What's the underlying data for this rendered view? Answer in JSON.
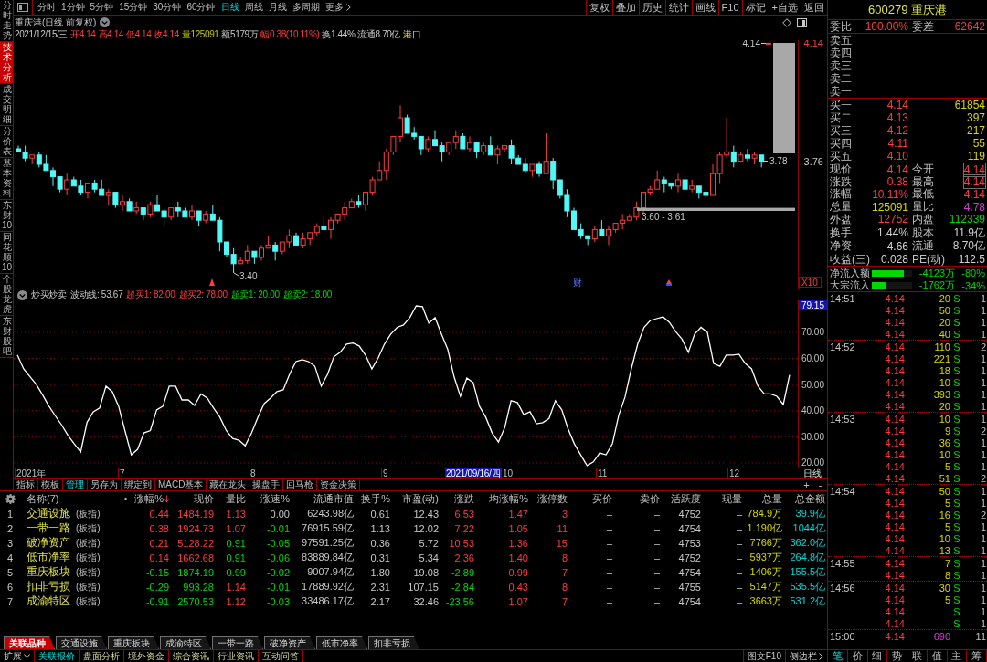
{
  "toolbar": {
    "periods": [
      {
        "label": "分时",
        "selected": false
      },
      {
        "label": "1分钟",
        "selected": false
      },
      {
        "label": "5分钟",
        "selected": false
      },
      {
        "label": "15分钟",
        "selected": false
      },
      {
        "label": "30分钟",
        "selected": false
      },
      {
        "label": "60分钟",
        "selected": false
      },
      {
        "label": "日线",
        "selected": true
      },
      {
        "label": "周线",
        "selected": false
      },
      {
        "label": "月线",
        "selected": false
      },
      {
        "label": "多周期",
        "selected": false
      }
    ],
    "more": "更多",
    "actions": [
      "复权",
      "叠加",
      "历史",
      "统计",
      "画线",
      "F10",
      "标记",
      "+自选",
      "返回"
    ]
  },
  "side_tabs": [
    {
      "label": "分时走势",
      "selected": false
    },
    {
      "label": "技术分析",
      "selected": true
    },
    {
      "label": "成交明细",
      "selected": false
    },
    {
      "label": "分价表",
      "selected": false
    },
    {
      "label": "基本资料",
      "selected": false
    },
    {
      "label": "东财10",
      "selected": false
    },
    {
      "label": "同花顺10",
      "selected": false
    },
    {
      "label": "个股龙虎",
      "selected": false
    },
    {
      "label": "东财股吧",
      "selected": false
    }
  ],
  "price_chart": {
    "title": "重庆港(日线 前复权)",
    "info": [
      {
        "text": "2021/12/15/三",
        "kind": "plain"
      },
      {
        "text": "开4.14",
        "kind": "rise"
      },
      {
        "text": "高4.14",
        "kind": "rise"
      },
      {
        "text": "低4.14",
        "kind": "rise"
      },
      {
        "text": "收4.14",
        "kind": "rise"
      },
      {
        "text": "量125091",
        "kind": "volume"
      },
      {
        "text": "额5179万",
        "kind": "plain"
      },
      {
        "text": "幅0.38(10.11%)",
        "kind": "rise"
      },
      {
        "text": "换1.44%",
        "kind": "plain"
      },
      {
        "text": "流通8.70亿",
        "kind": "plain"
      },
      {
        "text": "港口",
        "kind": "sector"
      }
    ],
    "high_label": "4.14",
    "gap_label": "3.78",
    "low_label": "3.40",
    "event_marker": "财",
    "scale": "X10",
    "chart_data": {
      "type": "candlestick",
      "categories": [
        null,
        null,
        null,
        null,
        null,
        null,
        null,
        null,
        null,
        null,
        null,
        null,
        null,
        null,
        null,
        null,
        null,
        null,
        null,
        null,
        null,
        null,
        null,
        null,
        null,
        null,
        null,
        null,
        null,
        null,
        null,
        null,
        null,
        null,
        null,
        null,
        null,
        null,
        null,
        null,
        null,
        null,
        null,
        null,
        null,
        null,
        null,
        null,
        null,
        null,
        null,
        null,
        null,
        null,
        null,
        null,
        null,
        null,
        null,
        null,
        null,
        null,
        null,
        null,
        null,
        null,
        null,
        null,
        null,
        null,
        null,
        null,
        null,
        null,
        null,
        null,
        null,
        null,
        null,
        null,
        null,
        null,
        null,
        null,
        null,
        null,
        null,
        null,
        null,
        null,
        null,
        null,
        null,
        null,
        null,
        null,
        null,
        null,
        null,
        null,
        null,
        null,
        null,
        null,
        null,
        null,
        null,
        null,
        null
      ],
      "ohlc": [
        [
          3.8,
          3.81,
          3.79,
          3.79
        ],
        [
          3.79,
          3.81,
          3.76,
          3.77
        ],
        [
          3.77,
          3.78,
          3.75,
          3.78
        ],
        [
          3.78,
          3.79,
          3.74,
          3.75
        ],
        [
          3.75,
          3.78,
          3.73,
          3.73
        ],
        [
          3.73,
          3.74,
          3.68,
          3.71
        ],
        [
          3.71,
          3.71,
          3.66,
          3.67
        ],
        [
          3.67,
          3.72,
          3.65,
          3.7
        ],
        [
          3.7,
          3.71,
          3.68,
          3.68
        ],
        [
          3.68,
          3.7,
          3.65,
          3.66
        ],
        [
          3.66,
          3.69,
          3.64,
          3.69
        ],
        [
          3.69,
          3.7,
          3.66,
          3.67
        ],
        [
          3.67,
          3.7,
          3.65,
          3.65
        ],
        [
          3.65,
          3.67,
          3.62,
          3.66
        ],
        [
          3.66,
          3.66,
          3.61,
          3.62
        ],
        [
          3.62,
          3.65,
          3.6,
          3.63
        ],
        [
          3.63,
          3.64,
          3.6,
          3.6
        ],
        [
          3.6,
          3.63,
          3.59,
          3.61
        ],
        [
          3.61,
          3.61,
          3.57,
          3.59
        ],
        [
          3.59,
          3.63,
          3.58,
          3.62
        ],
        [
          3.62,
          3.65,
          3.6,
          3.6
        ],
        [
          3.6,
          3.61,
          3.55,
          3.58
        ],
        [
          3.58,
          3.61,
          3.57,
          3.61
        ],
        [
          3.61,
          3.63,
          3.58,
          3.6
        ],
        [
          3.6,
          3.61,
          3.58,
          3.58
        ],
        [
          3.58,
          3.62,
          3.57,
          3.6
        ],
        [
          3.6,
          3.6,
          3.55,
          3.57
        ],
        [
          3.57,
          3.6,
          3.56,
          3.59
        ],
        [
          3.59,
          3.62,
          3.57,
          3.57
        ],
        [
          3.57,
          3.58,
          3.47,
          3.5
        ],
        [
          3.5,
          3.5,
          3.45,
          3.46
        ],
        [
          3.46,
          3.48,
          3.4,
          3.43
        ],
        [
          3.43,
          3.45,
          3.43,
          3.44
        ],
        [
          3.44,
          3.49,
          3.43,
          3.47
        ],
        [
          3.47,
          3.47,
          3.43,
          3.45
        ],
        [
          3.45,
          3.49,
          3.44,
          3.48
        ],
        [
          3.48,
          3.52,
          3.48,
          3.49
        ],
        [
          3.49,
          3.5,
          3.44,
          3.47
        ],
        [
          3.47,
          3.5,
          3.46,
          3.5
        ],
        [
          3.5,
          3.54,
          3.48,
          3.52
        ],
        [
          3.52,
          3.53,
          3.49,
          3.49
        ],
        [
          3.49,
          3.53,
          3.48,
          3.51
        ],
        [
          3.51,
          3.53,
          3.49,
          3.53
        ],
        [
          3.53,
          3.56,
          3.52,
          3.55
        ],
        [
          3.55,
          3.58,
          3.54,
          3.54
        ],
        [
          3.54,
          3.58,
          3.51,
          3.57
        ],
        [
          3.57,
          3.59,
          3.56,
          3.59
        ],
        [
          3.59,
          3.63,
          3.57,
          3.61
        ],
        [
          3.61,
          3.64,
          3.61,
          3.63
        ],
        [
          3.63,
          3.65,
          3.61,
          3.62
        ],
        [
          3.62,
          3.66,
          3.6,
          3.66
        ],
        [
          3.66,
          3.71,
          3.65,
          3.7
        ],
        [
          3.7,
          3.76,
          3.7,
          3.73
        ],
        [
          3.73,
          3.8,
          3.7,
          3.79
        ],
        [
          3.79,
          3.84,
          3.78,
          3.84
        ],
        [
          3.84,
          3.94,
          3.82,
          3.9
        ],
        [
          3.9,
          3.91,
          3.85,
          3.85
        ],
        [
          3.85,
          3.87,
          3.83,
          3.84
        ],
        [
          3.84,
          3.84,
          3.78,
          3.8
        ],
        [
          3.8,
          3.84,
          3.79,
          3.83
        ],
        [
          3.83,
          3.86,
          3.81,
          3.81
        ],
        [
          3.81,
          3.82,
          3.76,
          3.79
        ],
        [
          3.79,
          3.82,
          3.78,
          3.82
        ],
        [
          3.82,
          3.86,
          3.8,
          3.84
        ],
        [
          3.84,
          3.85,
          3.8,
          3.8
        ],
        [
          3.8,
          3.84,
          3.79,
          3.82
        ],
        [
          3.82,
          3.82,
          3.77,
          3.79
        ],
        [
          3.79,
          3.82,
          3.78,
          3.81
        ],
        [
          3.81,
          3.84,
          3.78,
          3.78
        ],
        [
          3.78,
          3.81,
          3.75,
          3.8
        ],
        [
          3.8,
          3.81,
          3.79,
          3.81
        ],
        [
          3.81,
          3.83,
          3.75,
          3.77
        ],
        [
          3.77,
          3.78,
          3.75,
          3.75
        ],
        [
          3.75,
          3.77,
          3.72,
          3.73
        ],
        [
          3.73,
          3.75,
          3.71,
          3.75
        ],
        [
          3.75,
          3.76,
          3.71,
          3.72
        ],
        [
          3.72,
          3.85,
          3.72,
          3.76
        ],
        [
          3.76,
          3.77,
          3.67,
          3.7
        ],
        [
          3.7,
          3.7,
          3.64,
          3.65
        ],
        [
          3.65,
          3.67,
          3.58,
          3.6
        ],
        [
          3.6,
          3.61,
          3.54,
          3.54
        ],
        [
          3.54,
          3.56,
          3.51,
          3.52
        ],
        [
          3.52,
          3.52,
          3.49,
          3.51
        ],
        [
          3.51,
          3.55,
          3.5,
          3.54
        ],
        [
          3.54,
          3.57,
          3.52,
          3.52
        ],
        [
          3.52,
          3.55,
          3.49,
          3.54
        ],
        [
          3.54,
          3.56,
          3.53,
          3.56
        ],
        [
          3.56,
          3.59,
          3.54,
          3.57
        ],
        [
          3.57,
          3.59,
          3.57,
          3.58
        ],
        [
          3.58,
          3.63,
          3.57,
          3.61
        ],
        [
          3.61,
          3.66,
          3.59,
          3.66
        ],
        [
          3.66,
          3.68,
          3.65,
          3.67
        ],
        [
          3.67,
          3.73,
          3.67,
          3.7
        ],
        [
          3.7,
          3.71,
          3.66,
          3.69
        ],
        [
          3.69,
          3.69,
          3.67,
          3.68
        ],
        [
          3.68,
          3.72,
          3.66,
          3.7
        ],
        [
          3.7,
          3.71,
          3.67,
          3.67
        ],
        [
          3.67,
          3.7,
          3.66,
          3.68
        ],
        [
          3.68,
          3.68,
          3.64,
          3.66
        ],
        [
          3.66,
          3.67,
          3.64,
          3.65
        ],
        [
          3.65,
          3.75,
          3.65,
          3.72
        ],
        [
          3.72,
          3.79,
          3.69,
          3.78
        ],
        [
          3.78,
          3.9,
          3.77,
          3.79
        ],
        [
          3.79,
          3.81,
          3.74,
          3.76
        ],
        [
          3.76,
          3.79,
          3.76,
          3.78
        ],
        [
          3.78,
          3.8,
          3.76,
          3.77
        ],
        [
          3.77,
          3.79,
          3.75,
          3.78
        ],
        [
          3.78,
          3.78,
          3.74,
          3.76
        ],
        [
          4.14,
          4.14,
          4.14,
          4.14
        ]
      ],
      "ylim": [
        3.35,
        4.15
      ],
      "yticks": [
        {
          "value": 4.14,
          "label": "4.14"
        },
        {
          "value": 3.76,
          "label": "3.76"
        }
      ],
      "bands": [
        {
          "axis": "y",
          "from": 3.6,
          "to": 3.61,
          "label": "3.60 - 3.61"
        }
      ]
    }
  },
  "indicator": {
    "name": "炒买炒卖",
    "readings": [
      {
        "text": "波动线: 53.67",
        "kind": "value"
      },
      {
        "text": "超买1: 82.00",
        "kind": "upper"
      },
      {
        "text": "超买2: 78.00",
        "kind": "upper"
      },
      {
        "text": "超卖1: 20.00",
        "kind": "lower"
      },
      {
        "text": "超卖2: 18.00",
        "kind": "lower"
      }
    ],
    "cursor_value": "79.15",
    "chart_data": {
      "type": "line",
      "grid": true,
      "series": [
        {
          "color": "#ffffff",
          "values": [
            61.3,
            56,
            53,
            50,
            46,
            41.7,
            38,
            34.5,
            30.5,
            27.3,
            24.2,
            35.5,
            39.6,
            41,
            49.4,
            47.3,
            41.7,
            32.4,
            23.1,
            25.2,
            31.5,
            32.4,
            40.3,
            41.7,
            49.4,
            49.4,
            44.1,
            44.1,
            42,
            46.4,
            44.8,
            41,
            37.5,
            32.4,
            29.4,
            28.7,
            26.6,
            31.5,
            37.5,
            42.7,
            44.8,
            47.3,
            48,
            53.9,
            58.8,
            59.5,
            58.8,
            57,
            49.4,
            53.9,
            60.6,
            62.3,
            65.5,
            65.9,
            64.8,
            61.3,
            56,
            60.2,
            65.5,
            69.3,
            71.9,
            72.8,
            75.6,
            80.1,
            79.8,
            73.5,
            75.6,
            69.3,
            63.4,
            52.9,
            45.5,
            52.5,
            50.8,
            41.7,
            37.5,
            31.5,
            28,
            33.5,
            43.8,
            43.1,
            38.5,
            39.6,
            35,
            35.4,
            37,
            43.8,
            40.3,
            33,
            27.3,
            23.1,
            19,
            20.4,
            23.8,
            23.1,
            27.3,
            38.2,
            45.2,
            56,
            65.5,
            71.9,
            74.5,
            75.2,
            75.9,
            73.8,
            70.3,
            67.4,
            62.3,
            69.3,
            71.9,
            70,
            58.1,
            57,
            61.3,
            61.3,
            61.6,
            58.1,
            56,
            49.4,
            46.4,
            46.4,
            45.5,
            42.4,
            53.7
          ]
        }
      ],
      "ylim": [
        17.9,
        82.2
      ],
      "yticks": [
        {
          "value": 70,
          "label": "70.00"
        },
        {
          "value": 60,
          "label": "60.00"
        },
        {
          "value": 50,
          "label": "50.00"
        },
        {
          "value": 40,
          "label": "40.00"
        },
        {
          "value": 30,
          "label": "30.00"
        },
        {
          "value": 20,
          "label": "20.00"
        }
      ]
    }
  },
  "date_axis": {
    "labels": [
      "2021年",
      "7",
      "8",
      "9",
      "10",
      "11",
      "12"
    ],
    "cursor": "2021/09/16/四",
    "period": "日线"
  },
  "indicator_tabs": [
    {
      "label": "指标",
      "selected": false
    },
    {
      "label": "模板",
      "selected": false
    },
    {
      "label": "管理",
      "selected": true
    },
    {
      "label": "另存为",
      "selected": false
    },
    {
      "label": "绑定到",
      "selected": false
    },
    {
      "label": "MACD基本",
      "selected": false
    },
    {
      "label": "藏在龙头",
      "selected": false
    },
    {
      "label": "操盘手",
      "selected": false
    },
    {
      "label": "回马枪",
      "selected": false
    },
    {
      "label": "资金决策",
      "selected": false
    }
  ],
  "zoom_buttons": [
    "+",
    "-"
  ],
  "table": {
    "name_header": "名称(7)",
    "columns": [
      {
        "label": "涨幅%",
        "sorted": true
      },
      {
        "label": "现价",
        "sorted": false
      },
      {
        "label": "量比",
        "sorted": false
      },
      {
        "label": "涨速%",
        "sorted": false
      },
      {
        "label": "流通市值",
        "sorted": false
      },
      {
        "label": "换手%",
        "sorted": false
      },
      {
        "label": "市盈(动)",
        "sorted": false
      },
      {
        "label": "涨跌",
        "sorted": false
      },
      {
        "label": "均涨幅%",
        "sorted": false
      },
      {
        "label": "涨停数",
        "sorted": false
      },
      {
        "label": "买价",
        "sorted": false
      },
      {
        "label": "卖价",
        "sorted": false
      },
      {
        "label": "活跃度",
        "sorted": false
      },
      {
        "label": "现量",
        "sorted": false
      },
      {
        "label": "总量",
        "sorted": false
      },
      {
        "label": "总金额",
        "sorted": false
      }
    ],
    "rows": [
      {
        "index": "1",
        "name": "交通设施",
        "tag": "(板指)",
        "cells": [
          {
            "text": "0.44",
            "kind": "up"
          },
          {
            "text": "1484.19",
            "kind": "up"
          },
          {
            "text": "1.13",
            "kind": "up"
          },
          {
            "text": "0.00",
            "kind": "flat"
          },
          {
            "text": "6243.98亿",
            "kind": "plain"
          },
          {
            "text": "0.61",
            "kind": "plain"
          },
          {
            "text": "12.43",
            "kind": "plain"
          },
          {
            "text": "6.53",
            "kind": "up"
          },
          {
            "text": "1.47",
            "kind": "up"
          },
          {
            "text": "3",
            "kind": "up"
          },
          {
            "text": "–",
            "kind": "plain"
          },
          {
            "text": "–",
            "kind": "plain"
          },
          {
            "text": "4752",
            "kind": "plain"
          },
          {
            "text": "–",
            "kind": "plain"
          },
          {
            "text": "784.9万",
            "kind": "volume"
          },
          {
            "text": "39.9亿",
            "kind": "amount"
          }
        ]
      },
      {
        "index": "2",
        "name": "一带一路",
        "tag": "(板指)",
        "cells": [
          {
            "text": "0.38",
            "kind": "up"
          },
          {
            "text": "1924.73",
            "kind": "up"
          },
          {
            "text": "1.07",
            "kind": "up"
          },
          {
            "text": "-0.01",
            "kind": "down"
          },
          {
            "text": "76915.59亿",
            "kind": "plain"
          },
          {
            "text": "1.13",
            "kind": "plain"
          },
          {
            "text": "12.02",
            "kind": "plain"
          },
          {
            "text": "7.22",
            "kind": "up"
          },
          {
            "text": "1.05",
            "kind": "up"
          },
          {
            "text": "11",
            "kind": "up"
          },
          {
            "text": "–",
            "kind": "plain"
          },
          {
            "text": "–",
            "kind": "plain"
          },
          {
            "text": "4754",
            "kind": "plain"
          },
          {
            "text": "–",
            "kind": "plain"
          },
          {
            "text": "1.190亿",
            "kind": "volume"
          },
          {
            "text": "1044亿",
            "kind": "amount"
          }
        ]
      },
      {
        "index": "3",
        "name": "破净资产",
        "tag": "(板指)",
        "cells": [
          {
            "text": "0.21",
            "kind": "up"
          },
          {
            "text": "5128.22",
            "kind": "up"
          },
          {
            "text": "0.91",
            "kind": "down"
          },
          {
            "text": "-0.05",
            "kind": "down"
          },
          {
            "text": "97591.25亿",
            "kind": "plain"
          },
          {
            "text": "0.36",
            "kind": "plain"
          },
          {
            "text": "5.72",
            "kind": "plain"
          },
          {
            "text": "10.53",
            "kind": "up"
          },
          {
            "text": "1.36",
            "kind": "up"
          },
          {
            "text": "15",
            "kind": "up"
          },
          {
            "text": "–",
            "kind": "plain"
          },
          {
            "text": "–",
            "kind": "plain"
          },
          {
            "text": "4753",
            "kind": "plain"
          },
          {
            "text": "–",
            "kind": "plain"
          },
          {
            "text": "7766万",
            "kind": "volume"
          },
          {
            "text": "362.0亿",
            "kind": "amount"
          }
        ]
      },
      {
        "index": "4",
        "name": "低市净率",
        "tag": "(板指)",
        "cells": [
          {
            "text": "0.14",
            "kind": "up"
          },
          {
            "text": "1662.68",
            "kind": "up"
          },
          {
            "text": "0.91",
            "kind": "down"
          },
          {
            "text": "-0.06",
            "kind": "down"
          },
          {
            "text": "83889.84亿",
            "kind": "plain"
          },
          {
            "text": "0.31",
            "kind": "plain"
          },
          {
            "text": "5.34",
            "kind": "plain"
          },
          {
            "text": "2.36",
            "kind": "up"
          },
          {
            "text": "1.40",
            "kind": "up"
          },
          {
            "text": "8",
            "kind": "up"
          },
          {
            "text": "–",
            "kind": "plain"
          },
          {
            "text": "–",
            "kind": "plain"
          },
          {
            "text": "4752",
            "kind": "plain"
          },
          {
            "text": "–",
            "kind": "plain"
          },
          {
            "text": "5937万",
            "kind": "volume"
          },
          {
            "text": "264.8亿",
            "kind": "amount"
          }
        ]
      },
      {
        "index": "5",
        "name": "重庆板块",
        "tag": "(板指)",
        "cells": [
          {
            "text": "-0.15",
            "kind": "down"
          },
          {
            "text": "1874.19",
            "kind": "down"
          },
          {
            "text": "0.99",
            "kind": "down"
          },
          {
            "text": "-0.02",
            "kind": "down"
          },
          {
            "text": "9007.94亿",
            "kind": "plain"
          },
          {
            "text": "1.80",
            "kind": "plain"
          },
          {
            "text": "19.08",
            "kind": "plain"
          },
          {
            "text": "-2.89",
            "kind": "down"
          },
          {
            "text": "0.99",
            "kind": "up"
          },
          {
            "text": "7",
            "kind": "up"
          },
          {
            "text": "–",
            "kind": "plain"
          },
          {
            "text": "–",
            "kind": "plain"
          },
          {
            "text": "4754",
            "kind": "plain"
          },
          {
            "text": "–",
            "kind": "plain"
          },
          {
            "text": "1406万",
            "kind": "volume"
          },
          {
            "text": "155.5亿",
            "kind": "amount"
          }
        ]
      },
      {
        "index": "6",
        "name": "扣非亏损",
        "tag": "(板指)",
        "cells": [
          {
            "text": "-0.29",
            "kind": "down"
          },
          {
            "text": "993.28",
            "kind": "down"
          },
          {
            "text": "1.14",
            "kind": "up"
          },
          {
            "text": "-0.01",
            "kind": "down"
          },
          {
            "text": "17889.92亿",
            "kind": "plain"
          },
          {
            "text": "2.31",
            "kind": "plain"
          },
          {
            "text": "107.15",
            "kind": "plain"
          },
          {
            "text": "-2.84",
            "kind": "down"
          },
          {
            "text": "0.43",
            "kind": "up"
          },
          {
            "text": "8",
            "kind": "up"
          },
          {
            "text": "–",
            "kind": "plain"
          },
          {
            "text": "–",
            "kind": "plain"
          },
          {
            "text": "4755",
            "kind": "plain"
          },
          {
            "text": "–",
            "kind": "plain"
          },
          {
            "text": "5147万",
            "kind": "volume"
          },
          {
            "text": "535.5亿",
            "kind": "amount"
          }
        ]
      },
      {
        "index": "7",
        "name": "成渝特区",
        "tag": "(板指)",
        "cells": [
          {
            "text": "-0.91",
            "kind": "down"
          },
          {
            "text": "2570.53",
            "kind": "down"
          },
          {
            "text": "1.12",
            "kind": "up"
          },
          {
            "text": "-0.03",
            "kind": "down"
          },
          {
            "text": "33486.17亿",
            "kind": "plain"
          },
          {
            "text": "2.17",
            "kind": "plain"
          },
          {
            "text": "32.46",
            "kind": "plain"
          },
          {
            "text": "-23.56",
            "kind": "down"
          },
          {
            "text": "1.07",
            "kind": "up"
          },
          {
            "text": "7",
            "kind": "up"
          },
          {
            "text": "–",
            "kind": "plain"
          },
          {
            "text": "–",
            "kind": "plain"
          },
          {
            "text": "4754",
            "kind": "plain"
          },
          {
            "text": "–",
            "kind": "plain"
          },
          {
            "text": "3663万",
            "kind": "volume"
          },
          {
            "text": "531.2亿",
            "kind": "amount"
          }
        ]
      }
    ]
  },
  "table_tabs": [
    {
      "label": "关联品种",
      "selected": true
    },
    {
      "label": "交通设施",
      "selected": false
    },
    {
      "label": "重庆板块",
      "selected": false
    },
    {
      "label": "成渝特区",
      "selected": false
    },
    {
      "label": "一带一路",
      "selected": false
    },
    {
      "label": "破净资产",
      "selected": false
    },
    {
      "label": "低市净率",
      "selected": false
    },
    {
      "label": "扣非亏损",
      "selected": false
    }
  ],
  "status_bar": {
    "menu": "扩展",
    "items": [
      {
        "label": "关联报价",
        "selected": true
      },
      {
        "label": "盘面分析",
        "selected": false
      },
      {
        "label": "境外资金",
        "selected": false
      },
      {
        "label": "综合资讯",
        "selected": false
      },
      {
        "label": "行业资讯",
        "selected": false
      },
      {
        "label": "互动问答",
        "selected": false
      }
    ],
    "right": [
      "图文F10",
      "侧边栏"
    ]
  },
  "quote_panel": {
    "title": "600279 重庆港",
    "ratio": {
      "label": "委比",
      "value": "100.00%",
      "diff_label": "委差",
      "diff": "62642"
    },
    "asks": [
      "卖五",
      "卖四",
      "卖三",
      "卖二",
      "卖一"
    ],
    "bids": [
      {
        "label": "买一",
        "price": "4.14",
        "volume": "61854"
      },
      {
        "label": "买二",
        "price": "4.13",
        "volume": "397"
      },
      {
        "label": "买三",
        "price": "4.12",
        "volume": "217"
      },
      {
        "label": "买四",
        "price": "4.11",
        "volume": "55"
      },
      {
        "label": "买五",
        "price": "4.10",
        "volume": "119"
      }
    ],
    "quote": [
      {
        "label": "现价",
        "value": "4.14",
        "color": "#ff3c3c",
        "boxed": false
      },
      {
        "label": "今开",
        "value": "4.14",
        "color": "#ff3c3c",
        "boxed": true
      },
      {
        "label": "涨跌",
        "value": "0.38",
        "color": "#ff3c3c",
        "boxed": false
      },
      {
        "label": "最高",
        "value": "4.14",
        "color": "#ff3c3c",
        "boxed": true
      },
      {
        "label": "涨幅",
        "value": "10.11%",
        "color": "#ff3c3c",
        "boxed": false
      },
      {
        "label": "最低",
        "value": "4.14",
        "color": "#ff3c3c",
        "boxed": false
      },
      {
        "label": "总量",
        "value": "125091",
        "color": "#d8d800",
        "boxed": false
      },
      {
        "label": "量比",
        "value": "4.78",
        "color": "#d040d0",
        "boxed": false
      },
      {
        "label": "外盘",
        "value": "12752",
        "color": "#ff3c3c",
        "boxed": false
      },
      {
        "label": "内盘",
        "value": "112339",
        "color": "#00d800",
        "boxed": false
      }
    ],
    "stats": [
      {
        "label": "换手",
        "value": "1.44%"
      },
      {
        "label": "股本",
        "value": "11.9亿"
      },
      {
        "label": "净资",
        "value": "4.66"
      },
      {
        "label": "流通",
        "value": "8.70亿"
      },
      {
        "label": "收益(三)",
        "value": "0.028"
      },
      {
        "label": "PE(动)",
        "value": "112.5"
      }
    ],
    "flows": [
      {
        "label": "净流入额",
        "level": 0.8,
        "amount": "-4123万",
        "percent": "-80%"
      },
      {
        "label": "大宗流入",
        "level": 0.34,
        "amount": "-1762万",
        "percent": "-34%"
      }
    ]
  },
  "trades": [
    {
      "time": "14:51",
      "trades": [
        {
          "price": "4.14",
          "volume": "20",
          "side": "S",
          "count": "1",
          "kind": "trade"
        },
        {
          "price": "4.14",
          "volume": "50",
          "side": "S",
          "count": "1",
          "kind": "trade"
        },
        {
          "price": "4.14",
          "volume": "20",
          "side": "S",
          "count": "1",
          "kind": "trade"
        },
        {
          "price": "4.14",
          "volume": "40",
          "side": "S",
          "count": "1",
          "kind": "trade"
        }
      ]
    },
    {
      "time": "14:52",
      "trades": [
        {
          "price": "4.14",
          "volume": "110",
          "side": "S",
          "count": "2",
          "kind": "trade"
        },
        {
          "price": "4.14",
          "volume": "221",
          "side": "S",
          "count": "1",
          "kind": "trade"
        },
        {
          "price": "4.14",
          "volume": "18",
          "side": "S",
          "count": "1",
          "kind": "trade"
        },
        {
          "price": "4.14",
          "volume": "10",
          "side": "S",
          "count": "1",
          "kind": "trade"
        },
        {
          "price": "4.14",
          "volume": "393",
          "side": "S",
          "count": "1",
          "kind": "trade"
        },
        {
          "price": "4.14",
          "volume": "20",
          "side": "S",
          "count": "1",
          "kind": "trade"
        }
      ]
    },
    {
      "time": "14:53",
      "trades": [
        {
          "price": "4.14",
          "volume": "10",
          "side": "S",
          "count": "1",
          "kind": "trade"
        },
        {
          "price": "4.14",
          "volume": "9",
          "side": "S",
          "count": "2",
          "kind": "trade"
        },
        {
          "price": "4.14",
          "volume": "36",
          "side": "S",
          "count": "1",
          "kind": "trade"
        },
        {
          "price": "4.14",
          "volume": "10",
          "side": "S",
          "count": "1",
          "kind": "trade"
        },
        {
          "price": "4.14",
          "volume": "5",
          "side": "S",
          "count": "1",
          "kind": "trade"
        },
        {
          "price": "4.14",
          "volume": "51",
          "side": "S",
          "count": "2",
          "kind": "trade"
        }
      ]
    },
    {
      "time": "14:54",
      "trades": [
        {
          "price": "4.14",
          "volume": "50",
          "side": "S",
          "count": "1",
          "kind": "trade"
        },
        {
          "price": "4.14",
          "volume": "5",
          "side": "S",
          "count": "1",
          "kind": "trade"
        },
        {
          "price": "4.14",
          "volume": "16",
          "side": "S",
          "count": "2",
          "kind": "trade"
        },
        {
          "price": "4.14",
          "volume": "5",
          "side": "S",
          "count": "1",
          "kind": "trade"
        },
        {
          "price": "4.14",
          "volume": "10",
          "side": "S",
          "count": "1",
          "kind": "trade"
        },
        {
          "price": "4.14",
          "volume": "13",
          "side": "S",
          "count": "1",
          "kind": "trade"
        }
      ]
    },
    {
      "time": "14:55",
      "trades": [
        {
          "price": "4.14",
          "volume": "7",
          "side": "S",
          "count": "1",
          "kind": "trade"
        },
        {
          "price": "4.14",
          "volume": "8",
          "side": "S",
          "count": "1",
          "kind": "trade"
        }
      ]
    },
    {
      "time": "14:56",
      "trades": [
        {
          "price": "4.14",
          "volume": "30",
          "side": "S",
          "count": "1",
          "kind": "trade"
        },
        {
          "price": "4.14",
          "volume": "5",
          "side": "S",
          "count": "1",
          "kind": "trade"
        },
        {
          "price": "4.14",
          "side": "S",
          "count": "1",
          "kind": "trade"
        },
        {
          "price": "4.14",
          "side": "S",
          "count": "1",
          "kind": "trade"
        }
      ]
    },
    {
      "time": "15:00",
      "trades": [
        {
          "price": "4.14",
          "volume": "690",
          "count": "11",
          "kind": "close"
        }
      ]
    }
  ],
  "trade_tabs": [
    {
      "label": "笔",
      "selected": true
    },
    {
      "label": "价",
      "selected": false
    },
    {
      "label": "细",
      "selected": false
    },
    {
      "label": "势",
      "selected": false
    },
    {
      "label": "联",
      "selected": false
    },
    {
      "label": "值",
      "selected": false
    },
    {
      "label": "主",
      "selected": false
    },
    {
      "label": "筹",
      "selected": false
    }
  ]
}
